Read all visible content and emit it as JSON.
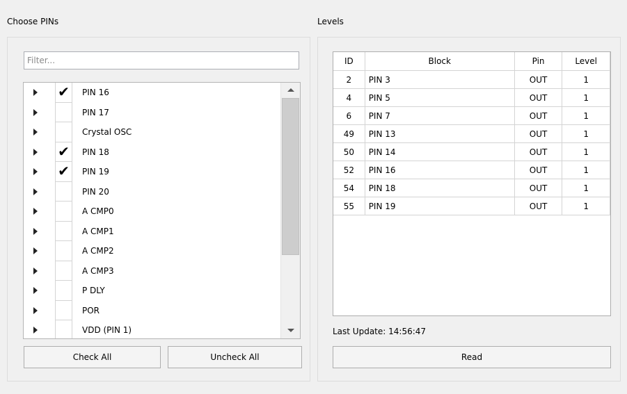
{
  "choose_pins": {
    "title": "Choose PINs",
    "filter_placeholder": "Filter...",
    "items": [
      {
        "label": "PIN 16",
        "checked": "✔"
      },
      {
        "label": "PIN 17",
        "checked": ""
      },
      {
        "label": "Crystal OSC",
        "checked": ""
      },
      {
        "label": "PIN 18",
        "checked": "✔"
      },
      {
        "label": "PIN 19",
        "checked": "✔"
      },
      {
        "label": "PIN 20",
        "checked": ""
      },
      {
        "label": "A CMP0",
        "checked": ""
      },
      {
        "label": "A CMP1",
        "checked": ""
      },
      {
        "label": "A CMP2",
        "checked": ""
      },
      {
        "label": "A CMP3",
        "checked": ""
      },
      {
        "label": "P DLY",
        "checked": ""
      },
      {
        "label": "POR",
        "checked": ""
      },
      {
        "label": "VDD (PIN 1)",
        "checked": ""
      }
    ],
    "check_all_label": "Check All",
    "uncheck_all_label": "Uncheck All"
  },
  "levels": {
    "title": "Levels",
    "columns": [
      "ID",
      "Block",
      "Pin",
      "Level"
    ],
    "rows": [
      [
        "2",
        "PIN 3",
        "OUT",
        "1"
      ],
      [
        "4",
        "PIN 5",
        "OUT",
        "1"
      ],
      [
        "6",
        "PIN 7",
        "OUT",
        "1"
      ],
      [
        "49",
        "PIN 13",
        "OUT",
        "1"
      ],
      [
        "50",
        "PIN 14",
        "OUT",
        "1"
      ],
      [
        "52",
        "PIN 16",
        "OUT",
        "1"
      ],
      [
        "54",
        "PIN 18",
        "OUT",
        "1"
      ],
      [
        "55",
        "PIN 19",
        "OUT",
        "1"
      ]
    ],
    "last_update": "Last Update: 14:56:47",
    "read_label": "Read"
  }
}
